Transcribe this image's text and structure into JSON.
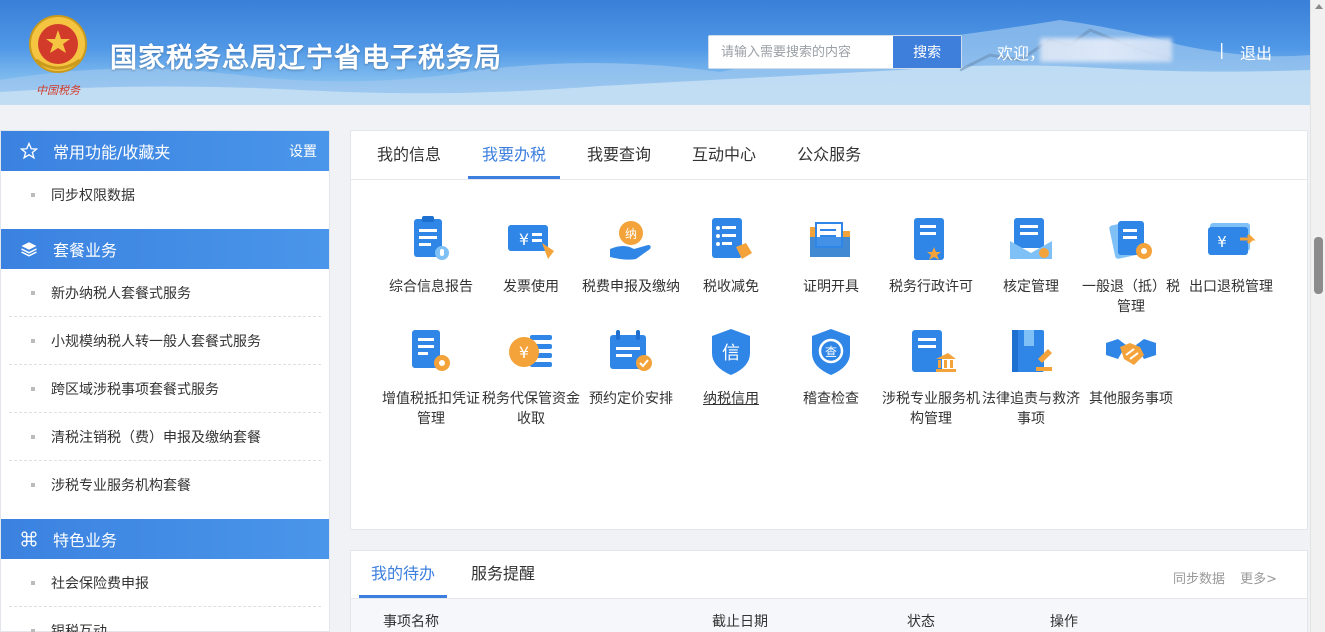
{
  "header": {
    "title": "国家税务总局辽宁省电子税务局",
    "search_placeholder": "请输入需要搜索的内容",
    "search_button": "搜索",
    "welcome": "欢迎，",
    "separator": "|",
    "logout": "退出",
    "emblem_text": "中国税务"
  },
  "sidebar": {
    "sections": [
      {
        "title": "常用功能/收藏夹",
        "icon": "star-icon",
        "setting": "设置",
        "items": [
          "同步权限数据"
        ]
      },
      {
        "title": "套餐业务",
        "icon": "layers-icon",
        "items": [
          "新办纳税人套餐式服务",
          "小规模纳税人转一般人套餐式服务",
          "跨区域涉税事项套餐式服务",
          "清税注销税（费）申报及缴纳套餐",
          "涉税专业服务机构套餐"
        ]
      },
      {
        "title": "特色业务",
        "icon": "command-icon",
        "items": [
          "社会保险费申报",
          "银税互动"
        ]
      }
    ]
  },
  "main": {
    "tabs": [
      "我的信息",
      "我要办税",
      "我要查询",
      "互动中心",
      "公众服务"
    ],
    "active_tab": "我要办税",
    "tiles": [
      {
        "label": "综合信息报告",
        "icon": "report-icon"
      },
      {
        "label": "发票使用",
        "icon": "invoice-icon"
      },
      {
        "label": "税费申报及缴纳",
        "icon": "tax-payment-icon"
      },
      {
        "label": "税收减免",
        "icon": "tax-relief-icon"
      },
      {
        "label": "证明开具",
        "icon": "certificate-icon"
      },
      {
        "label": "税务行政许可",
        "icon": "permit-icon"
      },
      {
        "label": "核定管理",
        "icon": "verify-icon"
      },
      {
        "label": "一般退（抵）税管理",
        "icon": "refund-icon"
      },
      {
        "label": "出口退税管理",
        "icon": "export-refund-icon"
      },
      {
        "label": "增值税抵扣凭证管理",
        "icon": "vat-icon"
      },
      {
        "label": "税务代保管资金收取",
        "icon": "fund-icon"
      },
      {
        "label": "预约定价安排",
        "icon": "pricing-icon"
      },
      {
        "label": "纳税信用",
        "icon": "credit-icon"
      },
      {
        "label": "稽查检查",
        "icon": "inspection-icon"
      },
      {
        "label": "涉税专业服务机构管理",
        "icon": "agency-icon"
      },
      {
        "label": "法律追责与救济事项",
        "icon": "law-icon"
      },
      {
        "label": "其他服务事项",
        "icon": "handshake-icon"
      }
    ]
  },
  "todo": {
    "tabs": [
      "我的待办",
      "服务提醒"
    ],
    "active_tab": "我的待办",
    "sync": "同步数据",
    "more": "更多>",
    "columns": [
      "事项名称",
      "截止日期",
      "状态",
      "操作"
    ]
  },
  "colors": {
    "primary": "#3c7fde",
    "icon_blue": "#2f86e6",
    "icon_orange": "#f3a33a"
  }
}
